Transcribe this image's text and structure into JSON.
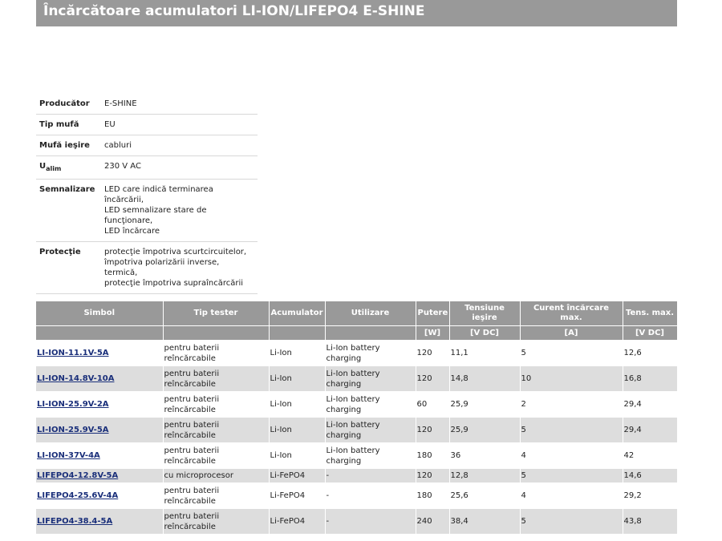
{
  "page": {
    "title": "Încărcătoare acumulatori LI-ION/LIFEPO4 E-SHINE"
  },
  "specs": [
    {
      "key": "Producător",
      "value": "E-SHINE"
    },
    {
      "key": "Tip mufă",
      "value": "EU"
    },
    {
      "key": "Mufă ieşire",
      "value": "cabluri"
    },
    {
      "key_main": "U",
      "key_sub": "alim",
      "value": "230 V AC"
    },
    {
      "key": "Semnalizare",
      "lines": [
        "LED care indică terminarea încărcării,",
        "LED semnalizare stare de funcţionare,",
        "LED încărcare"
      ]
    },
    {
      "key": "Protecţie",
      "lines": [
        "protecţie împotriva scurtcircuitelor,",
        "împotriva polarizării inverse,",
        "termică,",
        "protecţie împotriva supraîncărcării"
      ]
    }
  ],
  "table": {
    "headers": [
      "Simbol",
      "Tip tester",
      "Acumulator",
      "Utilizare",
      "Putere",
      "Tensiune ieşire",
      "Curent încărcare max.",
      "Tens. max."
    ],
    "units": [
      "",
      "",
      "",
      "",
      "[W]",
      "[V DC]",
      "[A]",
      "[V DC]"
    ],
    "rows": [
      {
        "simbol": "LI-ION-11.1V-5A",
        "tip": "pentru baterii reîncărcabile",
        "acumulator": "Li-Ion",
        "utilizare": "Li-Ion battery charging",
        "putere": "120",
        "tensiune": "11,1",
        "curent": "5",
        "tens_max": "12,6"
      },
      {
        "simbol": "LI-ION-14.8V-10A",
        "tip": "pentru baterii reîncărcabile",
        "acumulator": "Li-Ion",
        "utilizare": "Li-Ion battery charging",
        "putere": "120",
        "tensiune": "14,8",
        "curent": "10",
        "tens_max": "16,8"
      },
      {
        "simbol": "LI-ION-25.9V-2A",
        "tip": "pentru baterii reîncărcabile",
        "acumulator": "Li-Ion",
        "utilizare": "Li-Ion battery charging",
        "putere": "60",
        "tensiune": "25,9",
        "curent": "2",
        "tens_max": "29,4"
      },
      {
        "simbol": "LI-ION-25.9V-5A",
        "tip": "pentru baterii reîncărcabile",
        "acumulator": "Li-Ion",
        "utilizare": "Li-Ion battery charging",
        "putere": "120",
        "tensiune": "25,9",
        "curent": "5",
        "tens_max": "29,4"
      },
      {
        "simbol": "LI-ION-37V-4A",
        "tip": "pentru baterii reîncărcabile",
        "acumulator": "Li-Ion",
        "utilizare": "Li-Ion battery charging",
        "putere": "180",
        "tensiune": "36",
        "curent": "4",
        "tens_max": "42"
      },
      {
        "simbol": "LIFEPO4-12.8V-5A",
        "tip": "cu microprocesor",
        "acumulator": "Li-FePO4",
        "utilizare": "-",
        "putere": "120",
        "tensiune": "12,8",
        "curent": "5",
        "tens_max": "14,6"
      },
      {
        "simbol": "LIFEPO4-25.6V-4A",
        "tip": "pentru baterii reîncărcabile",
        "acumulator": "Li-FePO4",
        "utilizare": "-",
        "putere": "180",
        "tensiune": "25,6",
        "curent": "4",
        "tens_max": "29,2"
      },
      {
        "simbol": "LIFEPO4-38.4-5A",
        "tip": "pentru baterii reîncărcabile",
        "acumulator": "Li-FePO4",
        "utilizare": "-",
        "putere": "240",
        "tensiune": "38,4",
        "curent": "5",
        "tens_max": "43,8"
      }
    ]
  },
  "colors": {
    "header_bg": "#999999",
    "alt_row_bg": "#dddddd",
    "link": "#1a2f7a"
  }
}
